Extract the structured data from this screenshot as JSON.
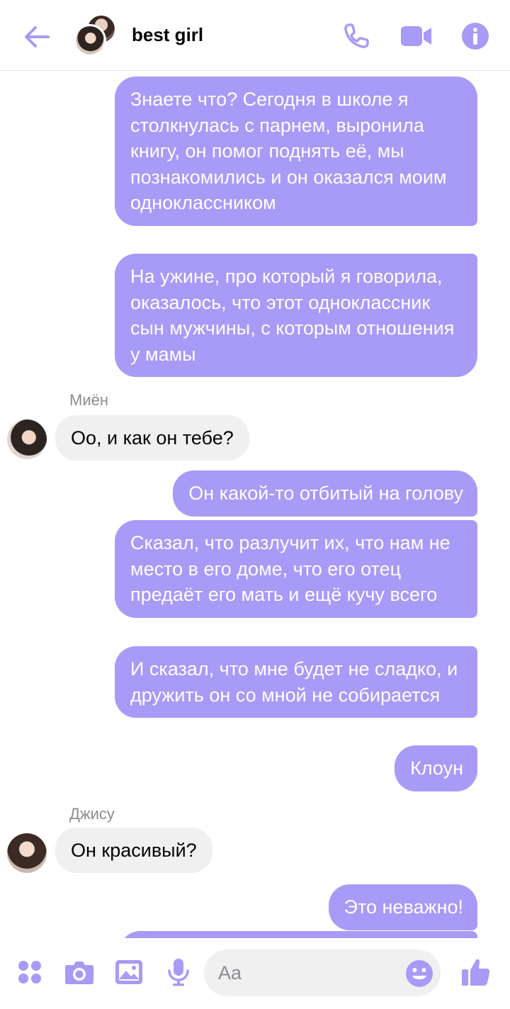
{
  "header": {
    "title": "best girl",
    "back_icon": "back-arrow-icon",
    "call_icon": "phone-icon",
    "video_icon": "video-camera-icon",
    "info_icon": "info-icon",
    "accent": "#a89af7"
  },
  "messages": {
    "out_1": "Знаете что? Сегодня в школе я столкнулась с парнем, выронила книгу, он помог поднять её, мы познакомились и он оказался моим одноклассником",
    "out_2": "На ужине, про который я говорила, оказалось, что этот одноклассник сын мужчины, с которым отношения у мамы",
    "sender_1": "Миён",
    "in_1": "Оо, и как он тебе?",
    "out_3": "Он какой-то отбитый на голову",
    "out_4": "Сказал, что разлучит их, что нам не место в его доме, что его отец предаёт его мать и ещё кучу всего",
    "out_5": "И сказал, что мне будет не сладко, и дружить он со мной не собирается",
    "out_6": "Клоун",
    "sender_2": "Джису",
    "in_2": "Он красивый?",
    "out_7": "Это неважно!",
    "bubble_out_color": "#a89af7",
    "bubble_in_color": "#f0f0f0"
  },
  "composer": {
    "placeholder": "Aa",
    "value": "",
    "icons": [
      "apps-icon",
      "camera-icon",
      "image-icon",
      "microphone-icon",
      "emoji-icon",
      "thumbs-up-icon"
    ]
  }
}
